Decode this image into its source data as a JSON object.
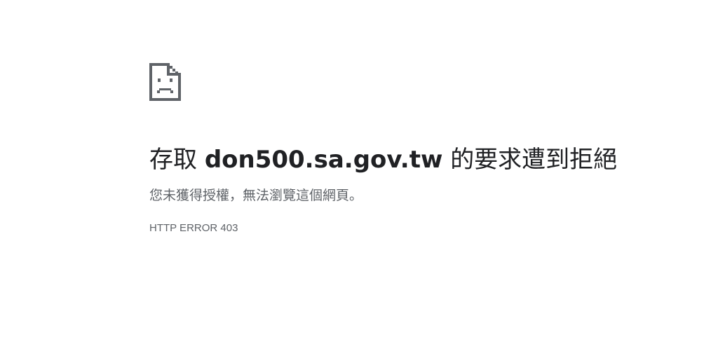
{
  "page": {
    "icon": "sad-page-icon",
    "headline_prefix": "存取",
    "headline_host": "don500.sa.gov.tw",
    "headline_suffix": "的要求遭到拒絕",
    "message": "您未獲得授權，無法瀏覽這個網頁。",
    "error_code": "HTTP ERROR 403"
  },
  "colors": {
    "icon": "#5f6368",
    "headline": "#202124",
    "secondary_text": "#5f6368",
    "background": "#ffffff"
  }
}
